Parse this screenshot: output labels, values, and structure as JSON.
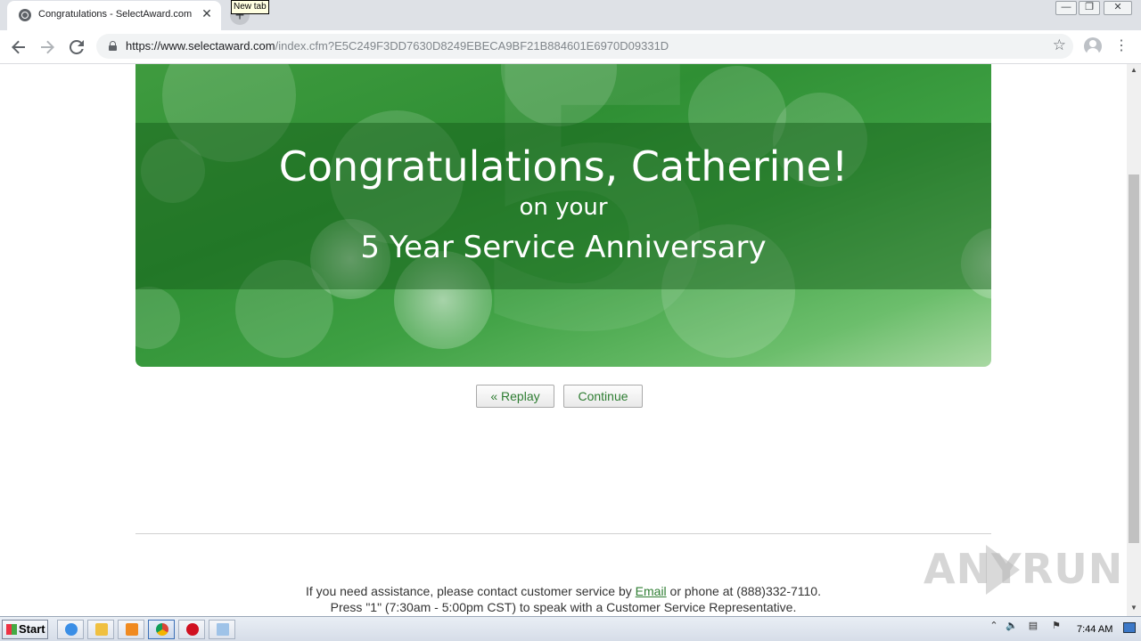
{
  "browser": {
    "tab_title": "Congratulations - SelectAward.com",
    "tab_close_glyph": "✕",
    "new_tab_tooltip": "New tab",
    "new_tab_glyph": "+",
    "url_host": "https://www.selectaward.com",
    "url_path": "/index.cfm?E5C249F3DD7630D8249EBECA9BF21B884601E6970D09331D",
    "window_controls": [
      "—",
      "❐",
      "✕"
    ]
  },
  "icons": {
    "back": "arrow-left-icon",
    "forward": "arrow-right-icon",
    "reload": "reload-icon",
    "lock": "lock-icon",
    "star": "star-icon",
    "profile": "profile-icon",
    "menu": "kebab-menu-icon"
  },
  "banner": {
    "big_number": "5",
    "headline": "Congratulations, Catherine!",
    "subline": "on your",
    "anniversary": "5 Year Service Anniversary"
  },
  "actions": {
    "replay_label": "« Replay",
    "continue_label": "Continue"
  },
  "footer": {
    "line1_prefix": "If you need assistance, please contact customer service by ",
    "email_link": "Email",
    "line1_suffix": " or phone at (888)332-7110.",
    "line2": "Press \"1\" (7:30am - 5:00pm CST) to speak with a Customer Service Representative."
  },
  "watermark": {
    "text_left": "ANY",
    "text_right": "RUN"
  },
  "taskbar": {
    "start_label": "Start",
    "clock": "7:44 AM"
  },
  "colors": {
    "accent_green": "#2e7d32",
    "banner_green": "#3f9b3f"
  }
}
